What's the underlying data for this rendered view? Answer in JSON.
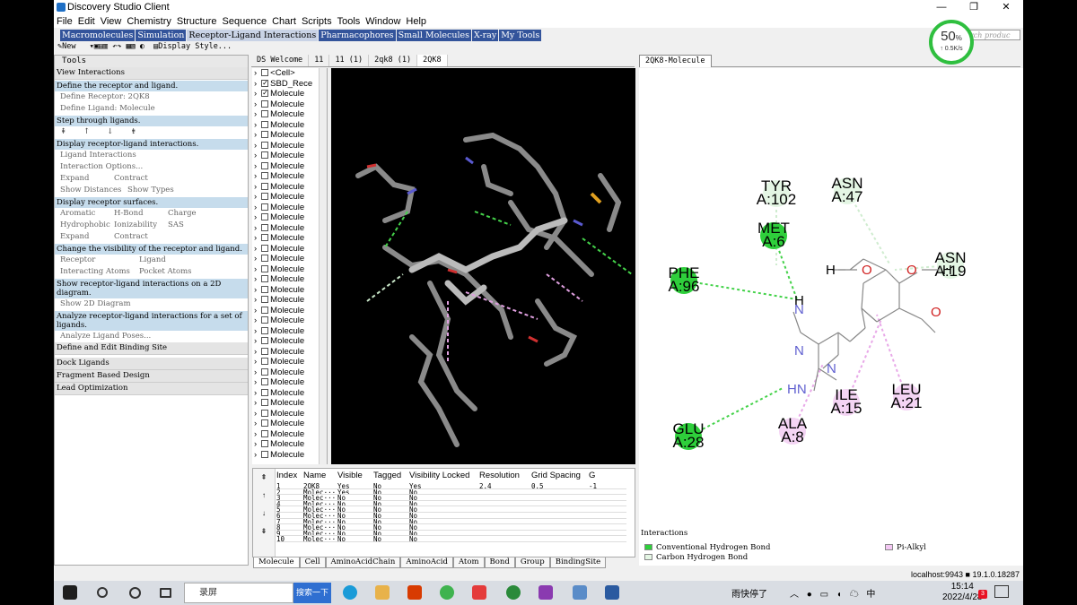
{
  "window": {
    "title": "Discovery Studio Client",
    "min": "—",
    "max": "❐",
    "close": "✕"
  },
  "menu": [
    "File",
    "Edit",
    "View",
    "Chemistry",
    "Structure",
    "Sequence",
    "Chart",
    "Scripts",
    "Tools",
    "Window",
    "Help"
  ],
  "task_tabs": [
    {
      "label": "Macromolecules",
      "sel": false
    },
    {
      "label": "Simulation",
      "sel": false
    },
    {
      "label": "Receptor-Ligand Interactions",
      "sel": true
    },
    {
      "label": "Pharmacophores",
      "sel": false
    },
    {
      "label": "Small Molecules",
      "sel": false
    },
    {
      "label": "X-ray",
      "sel": false
    },
    {
      "label": "My Tools",
      "sel": false
    }
  ],
  "search_placeholder": "Search produc",
  "toolbar": {
    "new": "New",
    "display_style": "Display Style..."
  },
  "gauge": {
    "percent": "50",
    "unit": "%",
    "speed": "↑ 0.5K/s"
  },
  "tools_panel": {
    "header": "Tools",
    "view_interactions": "View Interactions",
    "s1": "Define the receptor and ligand.",
    "s1_items": [
      "Define Receptor: 2QK8",
      "Define Ligand: Molecule"
    ],
    "s2": "Step through ligands.",
    "s3": "Display receptor-ligand interactions.",
    "s3_items": [
      "Ligand Interactions",
      "Interaction Options..."
    ],
    "expand": "Expand",
    "contract": "Contract",
    "show_distances": "Show Distances",
    "show_types": "Show Types",
    "s4": "Display receptor surfaces.",
    "surf": [
      [
        "Aromatic",
        "H-Bond",
        "Charge"
      ],
      [
        "Hydrophobic",
        "Ionizability",
        "SAS"
      ]
    ],
    "s5": "Change the visibility of the receptor and ligand.",
    "vis": [
      [
        "Receptor",
        "Ligand"
      ],
      [
        "Interacting Atoms",
        "Pocket Atoms"
      ]
    ],
    "s6": "Show receptor-ligand interactions on a 2D diagram.",
    "s6_item": "Show 2D Diagram",
    "s7": "Analyze receptor-ligand interactions for a set of ligands.",
    "s7_item": "Analyze Ligand Poses...",
    "collapsed": [
      "Define and Edit Binding Site",
      "Dock Ligands",
      "Fragment Based Design",
      "Lead Optimization"
    ]
  },
  "doc_tabs": [
    "DS Welcome",
    "11",
    "11 (1)",
    "2qk8 (1)",
    "2QK8"
  ],
  "right_tab": "2QK8-Molecule",
  "hierarchy": {
    "cell": "<Cell>",
    "sbd": "SBD_Rece",
    "molecule": "Molecule",
    "molecule_count": 36
  },
  "table": {
    "headers": [
      "Index",
      "Name",
      "Visible",
      "Tagged",
      "Visibility Locked",
      "Resolution",
      "Grid Spacing",
      "G"
    ],
    "rows": [
      [
        "1",
        "2QK8",
        "Yes",
        "No",
        "Yes",
        "2.4",
        "0.5",
        "-1"
      ],
      [
        "2",
        "Molec···",
        "Yes",
        "No",
        "No",
        "",
        "",
        ""
      ],
      [
        "3",
        "Molec···",
        "No",
        "No",
        "No",
        "",
        "",
        ""
      ],
      [
        "4",
        "Molec···",
        "No",
        "No",
        "No",
        "",
        "",
        ""
      ],
      [
        "5",
        "Molec···",
        "No",
        "No",
        "No",
        "",
        "",
        ""
      ],
      [
        "6",
        "Molec···",
        "No",
        "No",
        "No",
        "",
        "",
        ""
      ],
      [
        "7",
        "Molec···",
        "No",
        "No",
        "No",
        "",
        "",
        ""
      ],
      [
        "8",
        "Molec···",
        "No",
        "No",
        "No",
        "",
        "",
        ""
      ],
      [
        "9",
        "Molec···",
        "No",
        "No",
        "No",
        "",
        "",
        ""
      ],
      [
        "10",
        "Molec···",
        "No",
        "No",
        "No",
        "",
        "",
        ""
      ]
    ]
  },
  "bottom_tabs": [
    "Molecule",
    "Cell",
    "AminoAcidChain",
    "AminoAcid",
    "Atom",
    "Bond",
    "Group",
    "BindingSite"
  ],
  "diagram": {
    "residues": [
      {
        "name": "TYR",
        "id": "A:102",
        "color": "#e4f6e4"
      },
      {
        "name": "ASN",
        "id": "A:47",
        "color": "#e4f6e4"
      },
      {
        "name": "MET",
        "id": "A:6",
        "color": "#2ecf3b"
      },
      {
        "name": "ASN",
        "id": "A:19",
        "color": "#e4f6e4"
      },
      {
        "name": "PHE",
        "id": "A:96",
        "color": "#2ecf3b"
      },
      {
        "name": "ILE",
        "id": "A:15",
        "color": "#f4d4f4"
      },
      {
        "name": "LEU",
        "id": "A:21",
        "color": "#f4d4f4"
      },
      {
        "name": "ALA",
        "id": "A:8",
        "color": "#f4d4f4"
      },
      {
        "name": "GLU",
        "id": "A:28",
        "color": "#2ecf3b"
      }
    ],
    "atoms": {
      "H": "H",
      "O": "O",
      "N": "N",
      "HN": "HN"
    },
    "legend_title": "Interactions",
    "legend": [
      {
        "label": "Conventional Hydrogen Bond",
        "color": "#2ecf3b"
      },
      {
        "label": "Carbon Hydrogen Bond",
        "color": "#e4f6e4"
      },
      {
        "label": "Pi-Alkyl",
        "color": "#f4c8f4"
      }
    ]
  },
  "status": "localhost:9943 ■ 19.1.0.18287",
  "taskbar": {
    "app_label": "录屏",
    "search_btn": "搜索一下",
    "weather": "雨快停了",
    "ime": "中",
    "time": "15:14",
    "date": "2022/4/28",
    "badge": "3"
  }
}
